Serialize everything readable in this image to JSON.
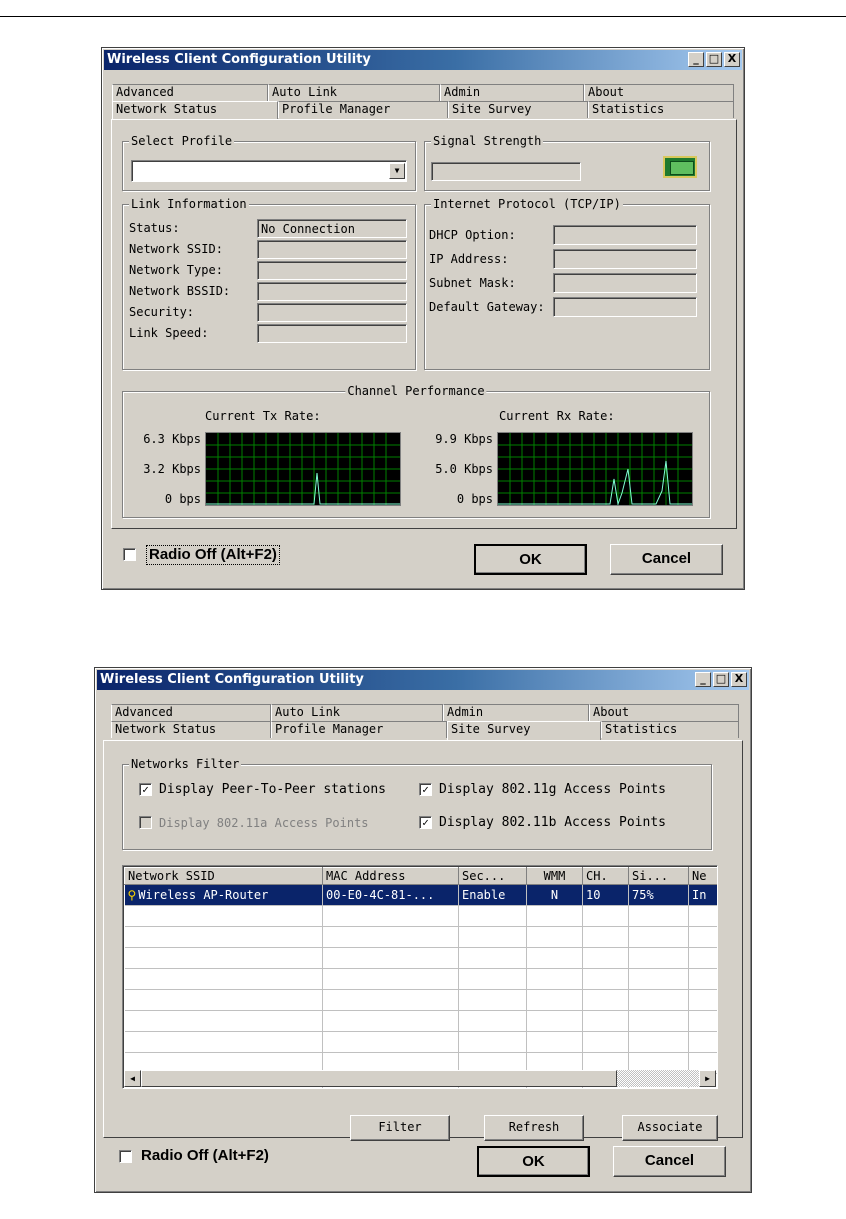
{
  "window_title": "Wireless Client Configuration Utility",
  "title_buttons": {
    "minimize": "_",
    "maximize": "□",
    "close": "X"
  },
  "tabs_top": [
    "Advanced",
    "Auto Link",
    "Admin",
    "About"
  ],
  "tabs_bottom": [
    "Network Status",
    "Profile Manager",
    "Site Survey",
    "Statistics"
  ],
  "window1": {
    "active_tab": "Network Status",
    "select_profile": {
      "label": "Select Profile",
      "value": ""
    },
    "signal_strength": {
      "label": "Signal Strength",
      "percent": 0
    },
    "link_info": {
      "label": "Link Information",
      "fields": [
        {
          "label": "Status:",
          "value": "No Connection"
        },
        {
          "label": "Network SSID:",
          "value": ""
        },
        {
          "label": "Network Type:",
          "value": ""
        },
        {
          "label": "Network BSSID:",
          "value": ""
        },
        {
          "label": "Security:",
          "value": ""
        },
        {
          "label": "Link Speed:",
          "value": ""
        }
      ]
    },
    "tcpip": {
      "label": "Internet Protocol (TCP/IP)",
      "fields": [
        {
          "label": "DHCP Option:",
          "value": ""
        },
        {
          "label": "IP Address:",
          "value": ""
        },
        {
          "label": "Subnet Mask:",
          "value": ""
        },
        {
          "label": "Default Gateway:",
          "value": ""
        }
      ]
    },
    "channel_performance": {
      "label": "Channel Performance",
      "tx": {
        "title": "Current Tx Rate:",
        "ticks": [
          "6.3 Kbps",
          "3.2 Kbps",
          "0 bps"
        ]
      },
      "rx": {
        "title": "Current Rx Rate:",
        "ticks": [
          "9.9 Kbps",
          "5.0 Kbps",
          "0 bps"
        ]
      }
    },
    "radio_off": {
      "label": "Radio Off (Alt+F2)",
      "checked": false
    },
    "ok": "OK",
    "cancel": "Cancel"
  },
  "window2": {
    "active_tab": "Site Survey",
    "networks_filter": {
      "label": "Networks Filter",
      "options": [
        {
          "label": "Display Peer-To-Peer stations",
          "checked": true,
          "enabled": true
        },
        {
          "label": "Display 802.11g Access Points",
          "checked": true,
          "enabled": true
        },
        {
          "label": "Display 802.11a Access Points",
          "checked": false,
          "enabled": false
        },
        {
          "label": "Display 802.11b Access Points",
          "checked": true,
          "enabled": true
        }
      ]
    },
    "table": {
      "columns": [
        "Network SSID",
        "MAC Address",
        "Sec...",
        "WMM",
        "CH.",
        "Si...",
        "Ne"
      ],
      "rows": [
        [
          "Wireless AP-Router",
          "00-E0-4C-81-...",
          "Enable",
          "N",
          "10",
          "75%",
          "In"
        ]
      ]
    },
    "buttons": {
      "filter": "Filter",
      "refresh": "Refresh",
      "associate": "Associate"
    },
    "radio_off": {
      "label": "Radio Off (Alt+F2)",
      "checked": false
    },
    "ok": "OK",
    "cancel": "Cancel"
  }
}
